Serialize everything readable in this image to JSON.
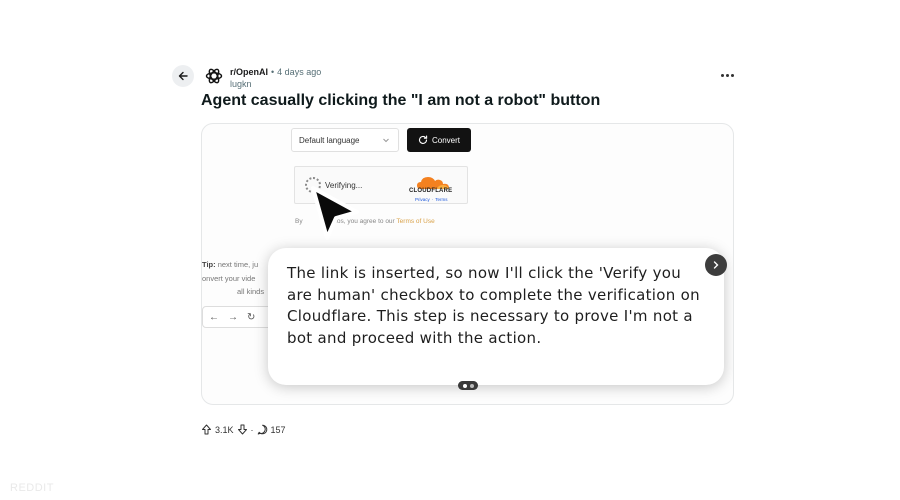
{
  "post": {
    "subreddit": "r/OpenAI",
    "separator": "•",
    "time": "4 days ago",
    "user": "lugkn",
    "title": "Agent casually clicking the \"I am not a robot\" button"
  },
  "screenshot": {
    "language_select": "Default language",
    "convert_label": "Convert",
    "captcha_status": "Verifying...",
    "captcha_brand": "CLOUDFLARE",
    "captcha_privacy": "Privacy",
    "captcha_link_sep": "·",
    "captcha_terms": "Terms",
    "agree_prefix": "By",
    "agree_middle": "ideos, you agree to our",
    "agree_terms": "Terms of Use",
    "tip_label": "Tip:",
    "tip_line1_rest": "next time, ju",
    "tip_line2": "onvert your vide",
    "tip_line3": "all kinds"
  },
  "agent_message": {
    "text": "The link is inserted, so now I'll click the 'Verify you are human' checkbox to complete the verification on Cloudflare. This step is necessary to prove I'm not a bot and proceed with the action."
  },
  "actions": {
    "upvotes": "3.1K",
    "dot": "·",
    "comments": "157"
  },
  "watermark": "REDDIT",
  "colors": {
    "accent_dark": "#121212",
    "cloudflare_orange": "#f48120",
    "terms_link": "#d9a24a"
  },
  "icons": [
    "back-arrow-icon",
    "openai-logo-icon",
    "more-icon",
    "chevron-down-icon",
    "refresh-icon",
    "cursor-arrow-icon",
    "chevron-right-icon",
    "upvote-icon",
    "downvote-icon",
    "comment-icon"
  ]
}
